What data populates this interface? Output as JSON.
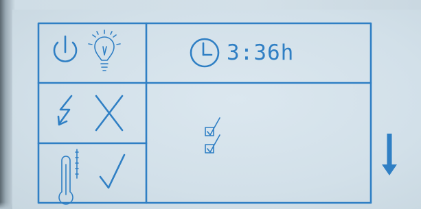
{
  "device": {
    "type": "lcd-status-display",
    "accent_color": "#2f7fc4",
    "background_color": "#d2e0e9"
  },
  "status": {
    "timer_text": "3:36h",
    "icons": [
      "power-icon",
      "light-bulb-icon",
      "clock-icon",
      "lightning-icon",
      "cross-icon",
      "thermometer-icon",
      "checkmark-icon",
      "checklist-icon",
      "arrow-down-icon"
    ]
  }
}
